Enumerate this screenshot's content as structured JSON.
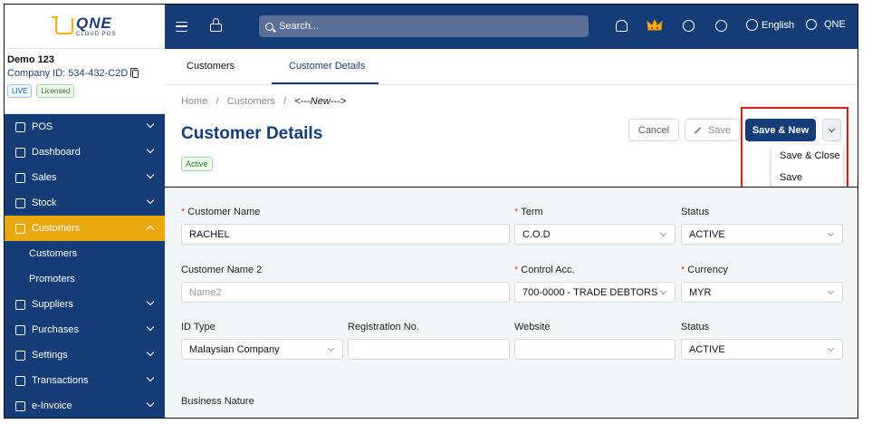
{
  "logo": {
    "main": "QNE",
    "sub": "CLOUD POS"
  },
  "company": {
    "name": "Demo 123",
    "id_text": "Company ID: 534-432-C2D",
    "badges": [
      "LIVE",
      "Licensed"
    ]
  },
  "nav": [
    {
      "label": "POS",
      "icon": "pos-icon"
    },
    {
      "label": "Dashboard",
      "icon": "dashboard-icon"
    },
    {
      "label": "Sales",
      "icon": "sales-icon"
    },
    {
      "label": "Stock",
      "icon": "stock-icon"
    },
    {
      "label": "Customers",
      "icon": "customers-icon",
      "active": true
    },
    {
      "label": "Suppliers",
      "icon": "suppliers-icon"
    },
    {
      "label": "Purchases",
      "icon": "purchases-icon"
    },
    {
      "label": "Settings",
      "icon": "settings-icon"
    },
    {
      "label": "Transactions",
      "icon": "transactions-icon"
    },
    {
      "label": "e-Invoice",
      "icon": "einvoice-icon"
    }
  ],
  "nav_sub": [
    "Customers",
    "Promoters"
  ],
  "topbar": {
    "search_placeholder": "Search...",
    "language": "English",
    "user": "QNE"
  },
  "tabs": [
    "Customers",
    "Customer Details"
  ],
  "breadcrumb": {
    "home": "Home",
    "sep": "/",
    "section": "Customers",
    "current": "<---New--->"
  },
  "page": {
    "title": "Customer Details",
    "status": "Active"
  },
  "buttons": {
    "cancel": "Cancel",
    "save": "Save",
    "save_new": "Save & New"
  },
  "dropdown": [
    "Save & Close",
    "Save"
  ],
  "form": {
    "customer_name": {
      "label": "Customer Name",
      "value": "RACHEL"
    },
    "term": {
      "label": "Term",
      "value": "C.O.D"
    },
    "status1": {
      "label": "Status",
      "value": "ACTIVE"
    },
    "customer_name2": {
      "label": "Customer Name 2",
      "placeholder": "Name2"
    },
    "control_acc": {
      "label": "Control Acc.",
      "value": "700-0000 - TRADE DEBTORS"
    },
    "currency": {
      "label": "Currency",
      "value": "MYR"
    },
    "id_type": {
      "label": "ID Type",
      "value": "Malaysian Company"
    },
    "reg_no": {
      "label": "Registration No.",
      "value": ""
    },
    "website": {
      "label": "Website",
      "value": ""
    },
    "status2": {
      "label": "Status",
      "value": "ACTIVE"
    },
    "business_nature": {
      "label": "Business Nature"
    }
  },
  "colors": {
    "primary": "#143d78",
    "accent": "#e9a90c",
    "highlight": "#e01818"
  }
}
